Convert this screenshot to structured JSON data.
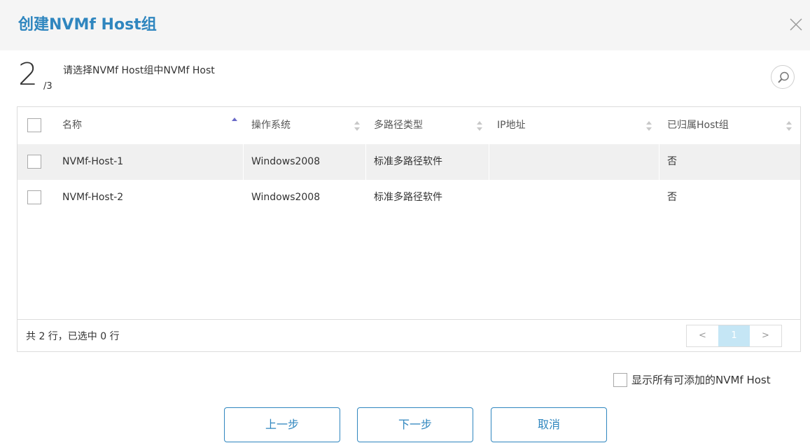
{
  "dialog": {
    "title": "创建NVMf Host组",
    "close_icon": "close-icon"
  },
  "step": {
    "current": "2",
    "total": "/3",
    "description": "请选择NVMf Host组中NVMf Host"
  },
  "search": {
    "icon": "search-icon"
  },
  "table": {
    "columns": [
      {
        "label": "名称",
        "sort": "asc"
      },
      {
        "label": "操作系统",
        "sort": "none"
      },
      {
        "label": "多路径类型",
        "sort": "none"
      },
      {
        "label": "IP地址",
        "sort": "none"
      },
      {
        "label": "已归属Host组",
        "sort": "none"
      }
    ],
    "rows": [
      {
        "name": "NVMf-Host-1",
        "os": "Windows2008",
        "multipath": "标准多路径软件",
        "ip": "",
        "group": "否",
        "selected": false
      },
      {
        "name": "NVMf-Host-2",
        "os": "Windows2008",
        "multipath": "标准多路径软件",
        "ip": "",
        "group": "否",
        "selected": false
      }
    ],
    "summary": "共 2 行，已选中 0 行",
    "pager": {
      "prev": "<",
      "page": "1",
      "next": ">"
    }
  },
  "options": {
    "show_all_label": "显示所有可添加的NVMf Host",
    "show_all_checked": false
  },
  "buttons": {
    "prev": "上一步",
    "next": "下一步",
    "cancel": "取消"
  },
  "colors": {
    "accent": "#2f86bf",
    "row_highlight": "#f0f0f0",
    "pager_active": "#c5e6f5"
  }
}
